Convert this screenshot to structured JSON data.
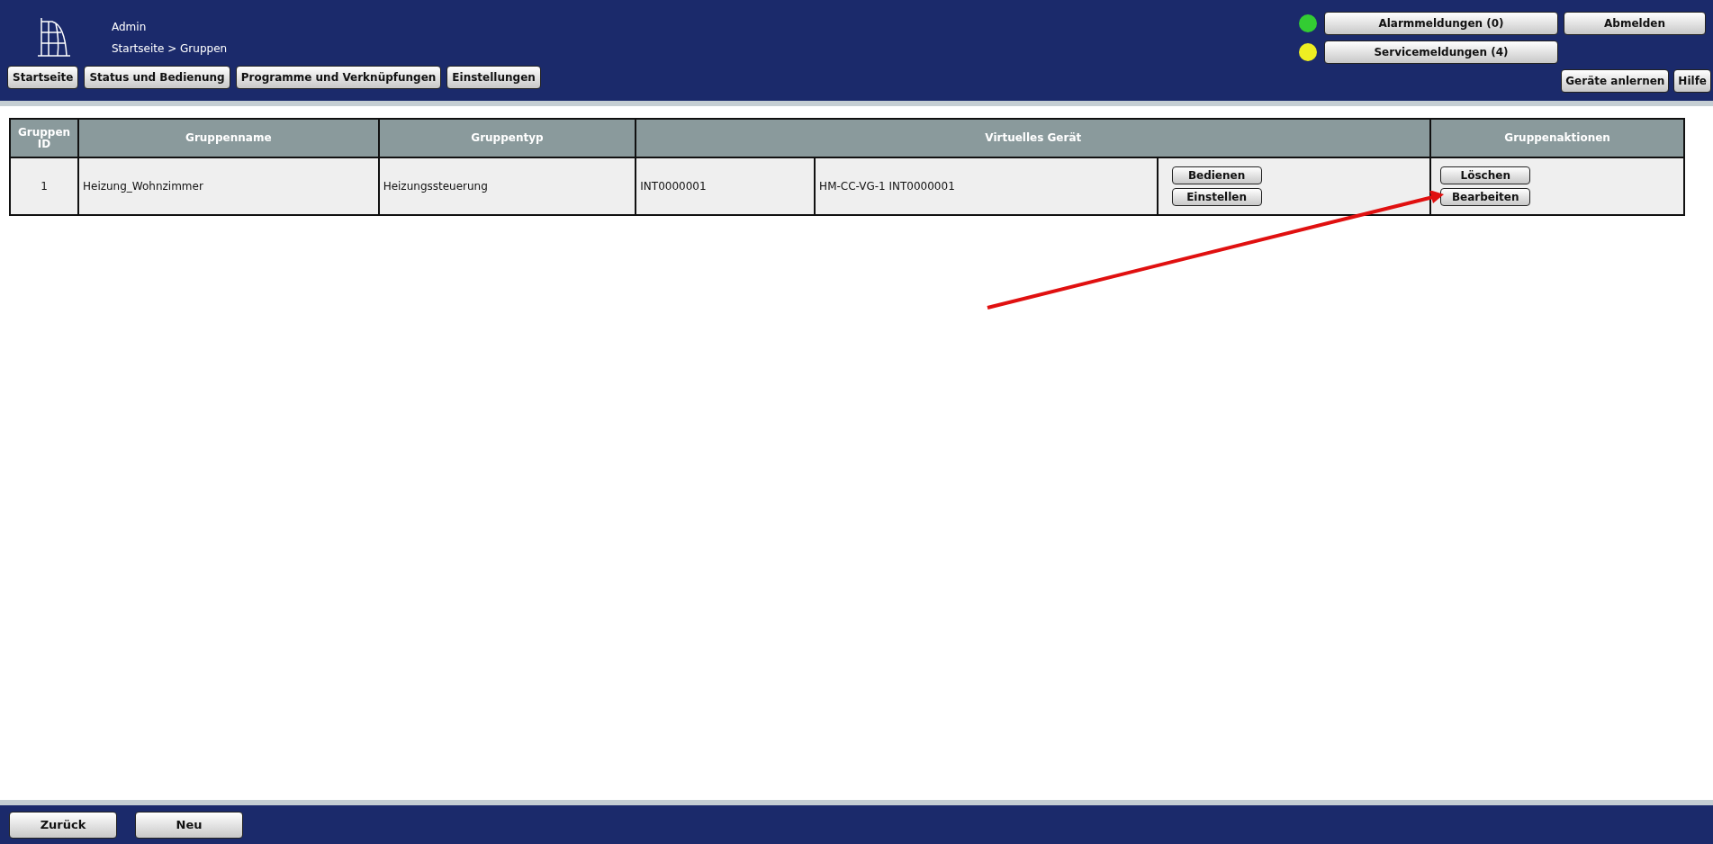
{
  "header": {
    "user": "Admin",
    "breadcrumb": "Startseite > Gruppen",
    "nav_buttons": [
      "Startseite",
      "Status und Bedienung",
      "Programme und Verknüpfungen",
      "Einstellungen"
    ],
    "messages": [
      {
        "label": "Alarmmeldungen (0)",
        "color": "#33cc33"
      },
      {
        "label": "Servicemeldungen (4)",
        "color": "#eeee22"
      }
    ],
    "logout": "Abmelden",
    "right_buttons": [
      "Geräte anlernen",
      "Hilfe"
    ]
  },
  "table": {
    "columns": [
      "Gruppen ID",
      "Gruppenname",
      "Gruppentyp",
      "Virtuelles Gerät",
      "Gruppenaktionen"
    ],
    "rows": [
      {
        "id": "1",
        "name": "Heizung_Wohnzimmer",
        "type": "Heizungssteuerung",
        "serial": "INT0000001",
        "device": "HM-CC-VG-1 INT0000001",
        "device_buttons": [
          "Bedienen",
          "Einstellen"
        ],
        "actions": [
          "Löschen",
          "Bearbeiten"
        ]
      }
    ]
  },
  "footer": {
    "buttons": [
      "Zurück",
      "Neu"
    ]
  }
}
